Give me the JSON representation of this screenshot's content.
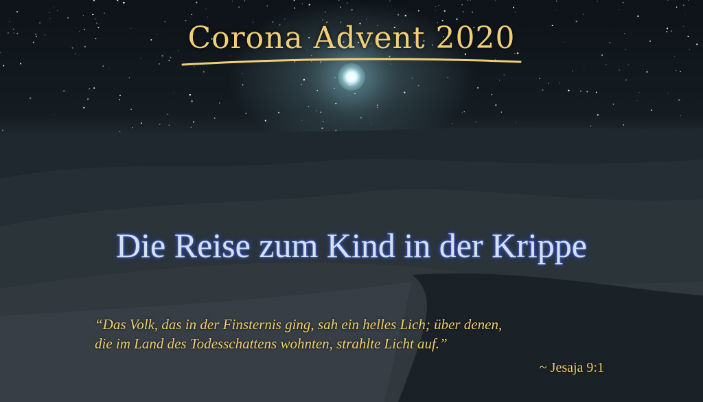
{
  "header": {
    "title": "Corona Advent 2020"
  },
  "main": {
    "subtitle": "Die Reise zum Kind in der Krippe"
  },
  "quote": {
    "line1": "“Das Volk, das in der Finsternis ging, sah ein helles Lich; über denen,",
    "line2": "die im Land des Todesschattens wohnten, strahlte Licht auf.”",
    "attribution": "~ Jesaja 9:1"
  },
  "colors": {
    "gold": "#f0cf72",
    "subtitle_text": "#d8e0f0",
    "subtitle_glow": "#3a5fd0"
  }
}
